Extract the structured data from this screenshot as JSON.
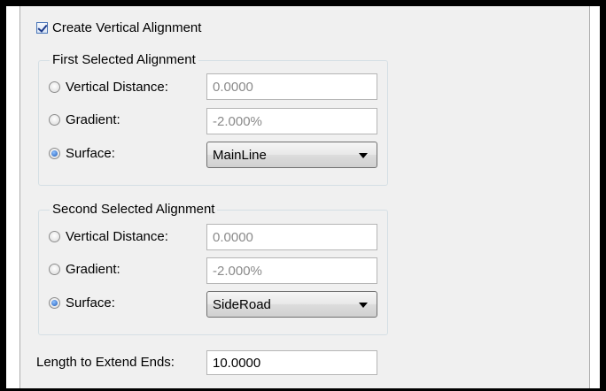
{
  "create_vertical_alignment": {
    "label": "Create Vertical Alignment",
    "checked": true
  },
  "first_alignment": {
    "title": "First Selected Alignment",
    "vertical_distance": {
      "label": "Vertical Distance:",
      "value": "0.0000",
      "selected": false
    },
    "gradient": {
      "label": "Gradient:",
      "value": "-2.000%",
      "selected": false
    },
    "surface": {
      "label": "Surface:",
      "value": "MainLine",
      "selected": true
    }
  },
  "second_alignment": {
    "title": "Second Selected Alignment",
    "vertical_distance": {
      "label": "Vertical Distance:",
      "value": "0.0000",
      "selected": false
    },
    "gradient": {
      "label": "Gradient:",
      "value": "-2.000%",
      "selected": false
    },
    "surface": {
      "label": "Surface:",
      "value": "SideRoad",
      "selected": true
    }
  },
  "extend_ends": {
    "label": "Length to Extend Ends:",
    "value": "10.0000"
  }
}
